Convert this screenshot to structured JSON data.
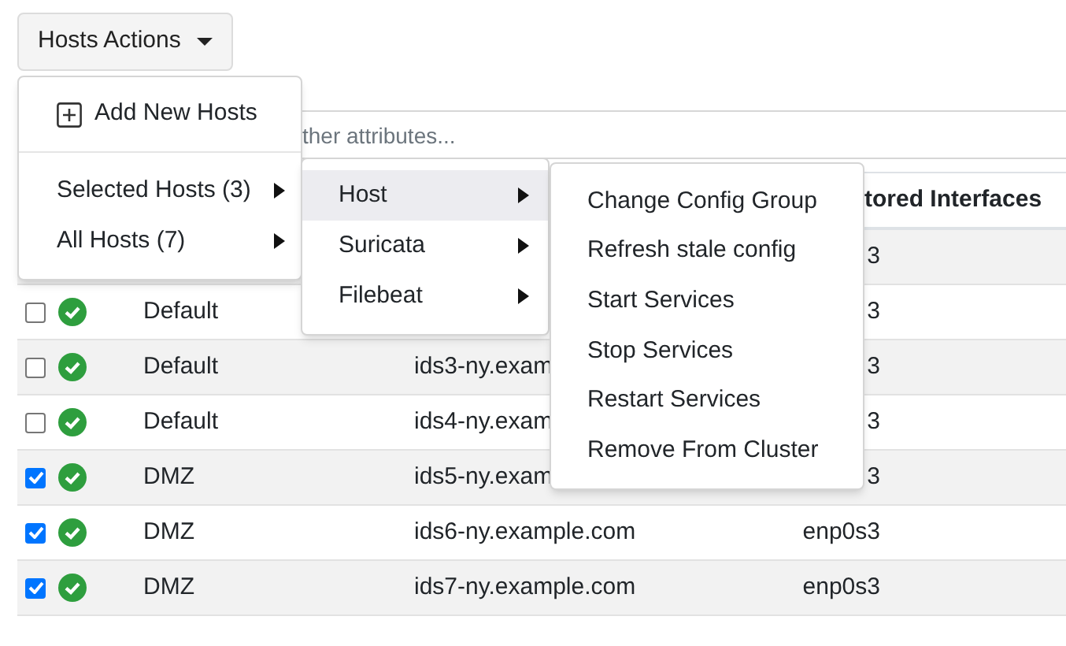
{
  "hosts_actions_button": {
    "label": "Hosts Actions"
  },
  "search": {
    "placeholder": "ther attributes..."
  },
  "table": {
    "columns": [
      {
        "label": "tored Interfaces"
      }
    ],
    "rows": [
      {
        "interfaces": "3"
      },
      {
        "checked": false,
        "group": "Default",
        "interfaces": "3"
      },
      {
        "checked": false,
        "group": "Default",
        "hostname": "ids3-ny.exam",
        "interfaces": "3"
      },
      {
        "checked": false,
        "group": "Default",
        "hostname": "ids4-ny.exam",
        "interfaces": "3"
      },
      {
        "checked": true,
        "group": "DMZ",
        "hostname": "ids5-ny.exam",
        "interfaces": "3"
      },
      {
        "checked": true,
        "group": "DMZ",
        "hostname": "ids6-ny.example.com",
        "interfaces": "enp0s3"
      },
      {
        "checked": true,
        "group": "DMZ",
        "hostname": "ids7-ny.example.com",
        "interfaces": "enp0s3"
      }
    ]
  },
  "actions_menu": {
    "items": [
      {
        "kind": "command",
        "label": "Add New Hosts"
      },
      {
        "kind": "submenu",
        "label": "Selected Hosts (3)"
      },
      {
        "kind": "submenu",
        "label": "All Hosts (7)"
      }
    ]
  },
  "target_menu": {
    "items": [
      {
        "label": "Host",
        "selected": true
      },
      {
        "label": "Suricata",
        "selected": false
      },
      {
        "label": "Filebeat",
        "selected": false
      }
    ]
  },
  "host_menu": {
    "items": [
      "Change Config Group",
      "Refresh stale config",
      "Start Services",
      "Stop Services",
      "Restart Services",
      "Remove From Cluster"
    ]
  }
}
